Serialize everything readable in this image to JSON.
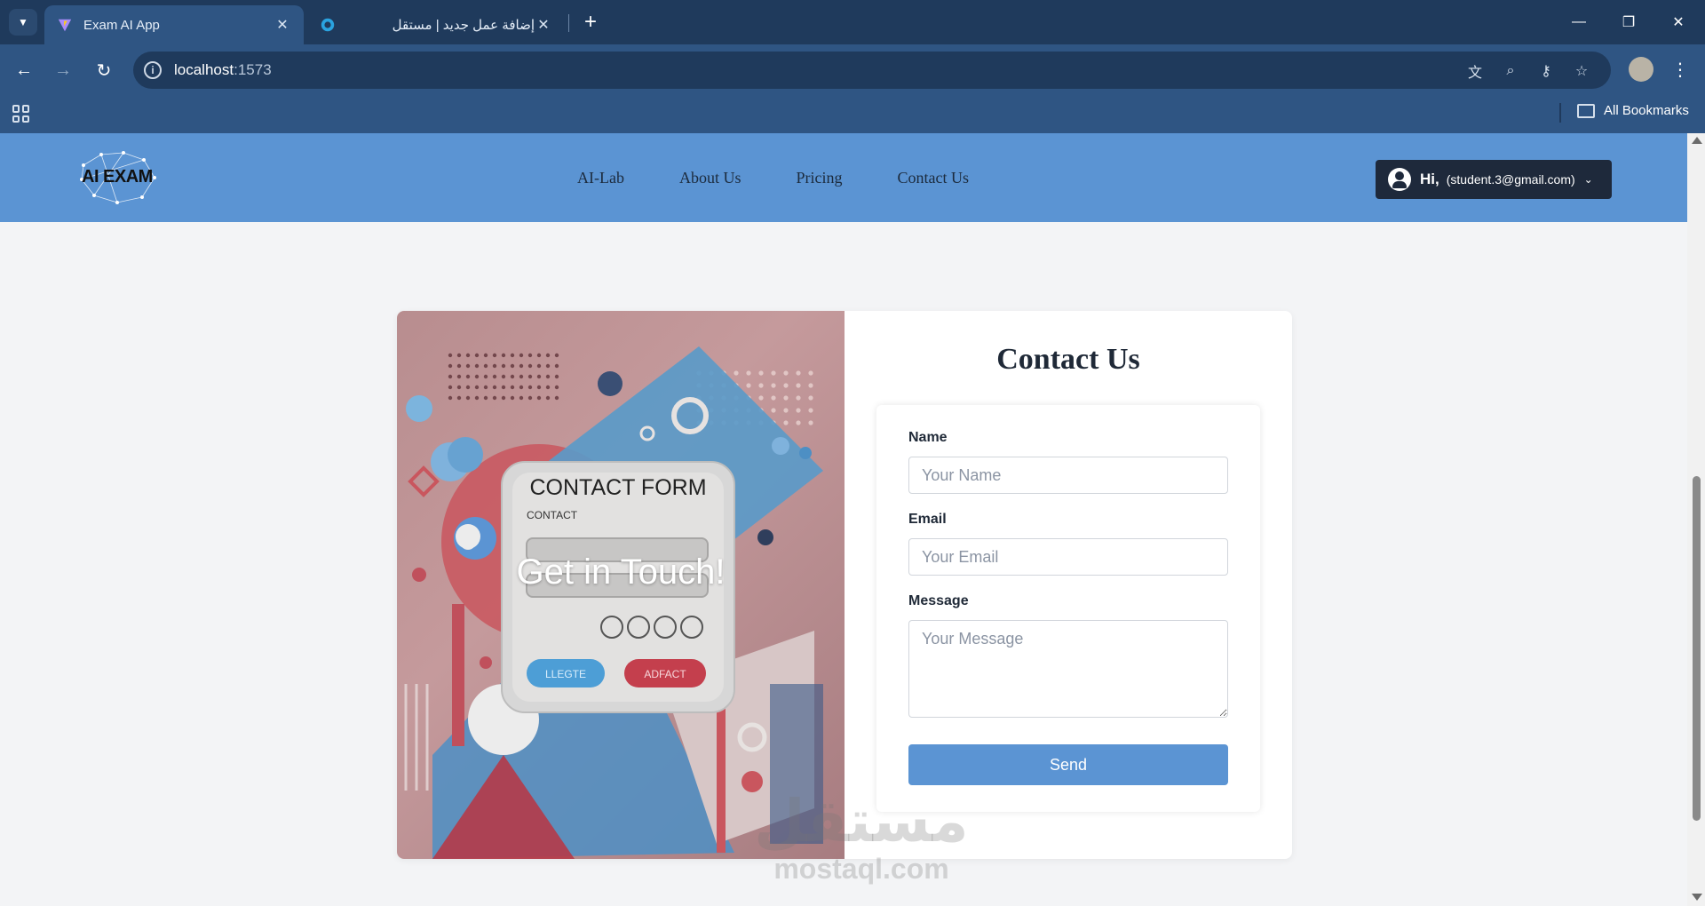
{
  "browser": {
    "tabs": [
      {
        "title": "Exam AI App",
        "active": true
      },
      {
        "title": "إضافة عمل جديد | مستقل",
        "active": false
      }
    ],
    "url_host": "localhost",
    "url_port": ":1573",
    "bookmarks_label": "All Bookmarks"
  },
  "site": {
    "logo_text": "AI EXAM",
    "nav": [
      "AI-Lab",
      "About Us",
      "Pricing",
      "Contact Us"
    ],
    "user_greeting": "Hi,",
    "user_email": "(student.3@gmail.com)"
  },
  "contact": {
    "image_text": "Get in Touch!",
    "title": "Contact Us",
    "name_label": "Name",
    "name_placeholder": "Your Name",
    "email_label": "Email",
    "email_placeholder": "Your Email",
    "message_label": "Message",
    "message_placeholder": "Your Message",
    "send_label": "Send"
  },
  "watermark": {
    "arabic": "مستقل",
    "latin": "mostaql.com"
  },
  "colors": {
    "header": "#5b94d3",
    "button": "#5b94d3",
    "user_btn": "#1e293b"
  }
}
